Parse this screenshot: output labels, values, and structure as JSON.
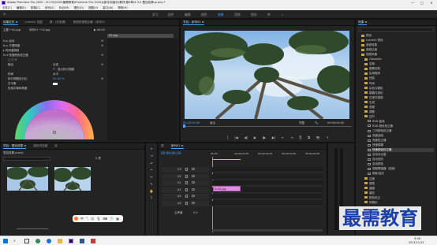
{
  "app": {
    "title": "Adobe Premiere Pro 2020 - D:\\79\\2020\\最需教育\\Premiere Pro 2020从新手到高手\\素材\\第4章\\4.3.0 叠加效果.prproj *",
    "window_controls": [
      "—",
      "□",
      "✕"
    ]
  },
  "menu": [
    "文件(F)",
    "编辑(E)",
    "剪辑(C)",
    "序列(S)",
    "标记(M)",
    "图形(G)",
    "视图(V)",
    "窗口(W)",
    "帮助(H)"
  ],
  "workspaces": {
    "home": "⌂",
    "items": [
      "学习",
      "组件",
      "编辑",
      "颜色",
      "效果",
      "音频",
      "图形",
      "库"
    ],
    "active_index": 4,
    "more": "»"
  },
  "effect_controls": {
    "tabs": [
      "效果控件 ≡",
      "Lumetri 范围",
      "源：(无剪辑)",
      "音频剪辑混合器：序列01"
    ],
    "active_tab": 0,
    "source_label": "主要 * 02.jpg",
    "clip_label": "序列01 * 02.jpg",
    "time_mark": "▶ 00:00",
    "clip_name": "02.jpg",
    "rows": [
      "fx ▸ 运动",
      "fx ▸ 不透明度",
      "▸ 时间重映射",
      "fx ▾ 快速颜色校正器",
      "○ □ ✎",
      "输出",
      "显示拆分视图",
      "布局",
      "拆分视图百分比",
      "白平衡",
      "色相平衡和角度"
    ],
    "output_value": "合成",
    "split_checkbox": "☐",
    "layout_value": "水平",
    "split_percent": "50.00 %",
    "reset_icons": "⟲"
  },
  "program_monitor": {
    "title": "节目：序列01 ≡",
    "timecode": "00:00:00:00",
    "fit": "适合",
    "quality": "完整",
    "duration": "00:00:04:00",
    "transport": [
      "{",
      "|◀",
      "◀|",
      "▶",
      "|▶",
      "▶|",
      "⇤",
      "⇥",
      "⎘",
      "⧉",
      "📷",
      "+"
    ]
  },
  "effects_panel": {
    "title": "效果 ≡",
    "items": [
      {
        "label": "预设",
        "depth": 1,
        "kind": "folder"
      },
      {
        "label": "Lumetri 预设",
        "depth": 1,
        "kind": "folder"
      },
      {
        "label": "音频效果",
        "depth": 1,
        "kind": "folder"
      },
      {
        "label": "音频过渡",
        "depth": 1,
        "kind": "folder"
      },
      {
        "label": "视频效果",
        "depth": 1,
        "kind": "folder"
      },
      {
        "label": "Obsolete",
        "depth": 2,
        "kind": "folder"
      },
      {
        "label": "变换",
        "depth": 2,
        "kind": "folder"
      },
      {
        "label": "图像控制",
        "depth": 2,
        "kind": "folder"
      },
      {
        "label": "实用程序",
        "depth": 2,
        "kind": "folder"
      },
      {
        "label": "扭曲",
        "depth": 2,
        "kind": "folder"
      },
      {
        "label": "时间",
        "depth": 2,
        "kind": "folder"
      },
      {
        "label": "杂色与颗粒",
        "depth": 2,
        "kind": "folder"
      },
      {
        "label": "模糊与锐化",
        "depth": 2,
        "kind": "folder"
      },
      {
        "label": "沉浸式视频",
        "depth": 2,
        "kind": "folder"
      },
      {
        "label": "生成",
        "depth": 2,
        "kind": "folder"
      },
      {
        "label": "视频",
        "depth": 2,
        "kind": "folder"
      },
      {
        "label": "调整",
        "depth": 2,
        "kind": "folder"
      },
      {
        "label": "过时",
        "depth": 2,
        "kind": "folder"
      },
      {
        "label": "RGB 曲线",
        "depth": 3,
        "kind": "fx"
      },
      {
        "label": "RGB 颜色校正器",
        "depth": 3,
        "kind": "fx"
      },
      {
        "label": "三向颜色校正器",
        "depth": 3,
        "kind": "fx"
      },
      {
        "label": "亮度曲线",
        "depth": 3,
        "kind": "fx"
      },
      {
        "label": "亮度校正器",
        "depth": 3,
        "kind": "fx"
      },
      {
        "label": "快速模糊",
        "depth": 3,
        "kind": "fx"
      },
      {
        "label": "快速颜色校正器",
        "depth": 3,
        "kind": "fx"
      },
      {
        "label": "自动对比度",
        "depth": 3,
        "kind": "fx"
      },
      {
        "label": "自动色阶",
        "depth": 3,
        "kind": "fx"
      },
      {
        "label": "自动颜色",
        "depth": 3,
        "kind": "fx"
      },
      {
        "label": "视频限幅器（旧版）",
        "depth": 3,
        "kind": "fx"
      },
      {
        "label": "阴影/高光",
        "depth": 3,
        "kind": "fx"
      },
      {
        "label": "过渡",
        "depth": 2,
        "kind": "folder"
      },
      {
        "label": "透视",
        "depth": 2,
        "kind": "folder"
      },
      {
        "label": "通道",
        "depth": 2,
        "kind": "folder"
      },
      {
        "label": "键控",
        "depth": 2,
        "kind": "folder"
      },
      {
        "label": "颜色校正",
        "depth": 2,
        "kind": "folder"
      },
      {
        "label": "风格化",
        "depth": 2,
        "kind": "folder"
      }
    ],
    "selected_index": 24
  },
  "project_panel": {
    "tabs": [
      "项目：叠加效果 ≡",
      "媒体浏览器",
      "库",
      "信息",
      "效果控件"
    ],
    "project_file": "叠加效果.prproj",
    "items_count": "2 项"
  },
  "timeline": {
    "tabs": [
      "源",
      "序列01 ≡"
    ],
    "timecode": "00:00:00:00",
    "ruler": [
      "00:00",
      "00:00:01:00",
      "00:00:02:00",
      "00:00:03:00",
      "00:00:04:00"
    ],
    "tracks": [
      {
        "name": "V3"
      },
      {
        "name": "V2"
      },
      {
        "name": "V1"
      },
      {
        "name": "A1"
      },
      {
        "name": "A2"
      },
      {
        "name": "A3"
      }
    ],
    "master": "主声道",
    "master_value": "0.0",
    "clip_name": "fx 02.jpg"
  },
  "taskbar": {
    "time": "9:46",
    "date": "2021/11/12",
    "language": "中"
  },
  "watermark": "最需教育",
  "colors": {
    "accent": "#4aa3ff",
    "clip": "#e28ee0",
    "playhead": "#4aa3ff",
    "watermark": "#1b3fa8"
  }
}
